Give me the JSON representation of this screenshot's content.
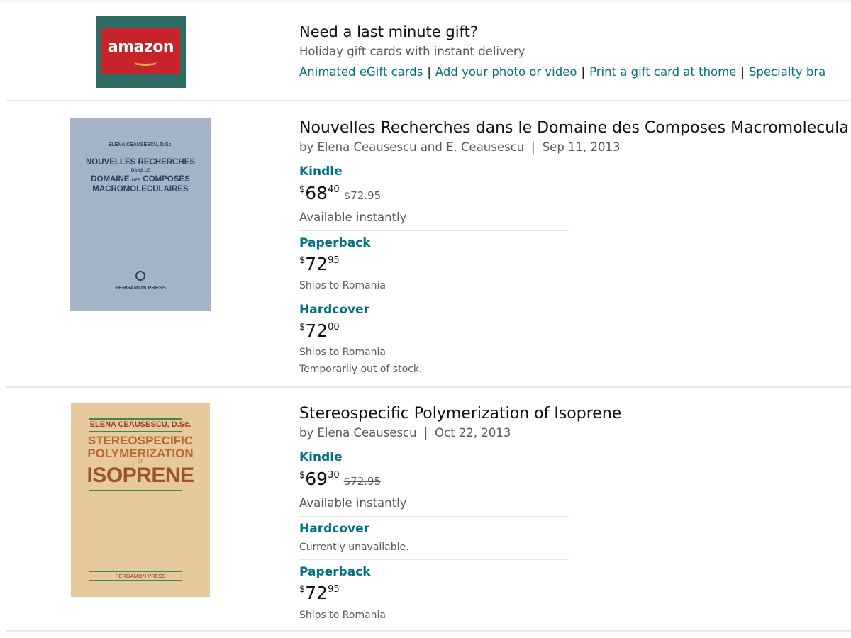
{
  "promo": {
    "logo_text": "amazon",
    "title": "Need a last minute gift?",
    "subtitle": "Holiday gift cards with instant delivery",
    "links": [
      "Animated eGift cards",
      "Add your photo or video",
      "Print a gift card at thome",
      "Specialty bra"
    ],
    "separator": "|"
  },
  "results": [
    {
      "title": "Nouvelles Recherches dans le Domaine des Composes Macromolecula",
      "byline": "by Elena Ceausescu and E. Ceausescu",
      "date": "Sep 11, 2013",
      "cover": {
        "author": "ELENA  CEAUSESCU, D.Sc.",
        "title_line1": "NOUVELLES RECHERCHES",
        "title_small": "DANS    LE",
        "title_line2": "DOMAINE",
        "title_small2": "DES",
        "title_line3": "COMPOSES",
        "title_line4": "MACROMOLECULAIRES",
        "publisher": "PERGAMON  PRESS",
        "color": "#a4b3c8"
      },
      "formats": [
        {
          "name": "Kindle",
          "currency": "$",
          "whole": "68",
          "fraction": "40",
          "list_price": "$72.95",
          "notes": [
            "Available instantly"
          ]
        },
        {
          "name": "Paperback",
          "currency": "$",
          "whole": "72",
          "fraction": "95",
          "list_price": "",
          "notes": [
            "Ships to Romania"
          ]
        },
        {
          "name": "Hardcover",
          "currency": "$",
          "whole": "72",
          "fraction": "00",
          "list_price": "",
          "notes": [
            "Ships to Romania",
            "Temporarily out of stock."
          ]
        }
      ]
    },
    {
      "title": "Stereospecific Polymerization of Isoprene",
      "byline": "by Elena Ceausescu",
      "date": "Oct 22, 2013",
      "cover": {
        "author": "ELENA CEAUSESCU, D.Sc.",
        "title_line1": "STEREOSPECIFIC",
        "title_line2": "POLYMERIZATION",
        "title_of": "OF",
        "title_line3": "ISOPRENE",
        "publisher": "PERGAMON PRESS",
        "color": "#e6c99c"
      },
      "formats": [
        {
          "name": "Kindle",
          "currency": "$",
          "whole": "69",
          "fraction": "30",
          "list_price": "$72.95",
          "notes": [
            "Available instantly"
          ]
        },
        {
          "name": "Hardcover",
          "currency": "",
          "whole": "",
          "fraction": "",
          "list_price": "",
          "notes": [
            "Currently unavailable."
          ]
        },
        {
          "name": "Paperback",
          "currency": "$",
          "whole": "72",
          "fraction": "95",
          "list_price": "",
          "notes": [
            "Ships to Romania"
          ]
        }
      ]
    }
  ],
  "colors": {
    "link": "#007185",
    "text": "#0f1111",
    "muted": "#565959",
    "divider": "#e3e6e6"
  }
}
